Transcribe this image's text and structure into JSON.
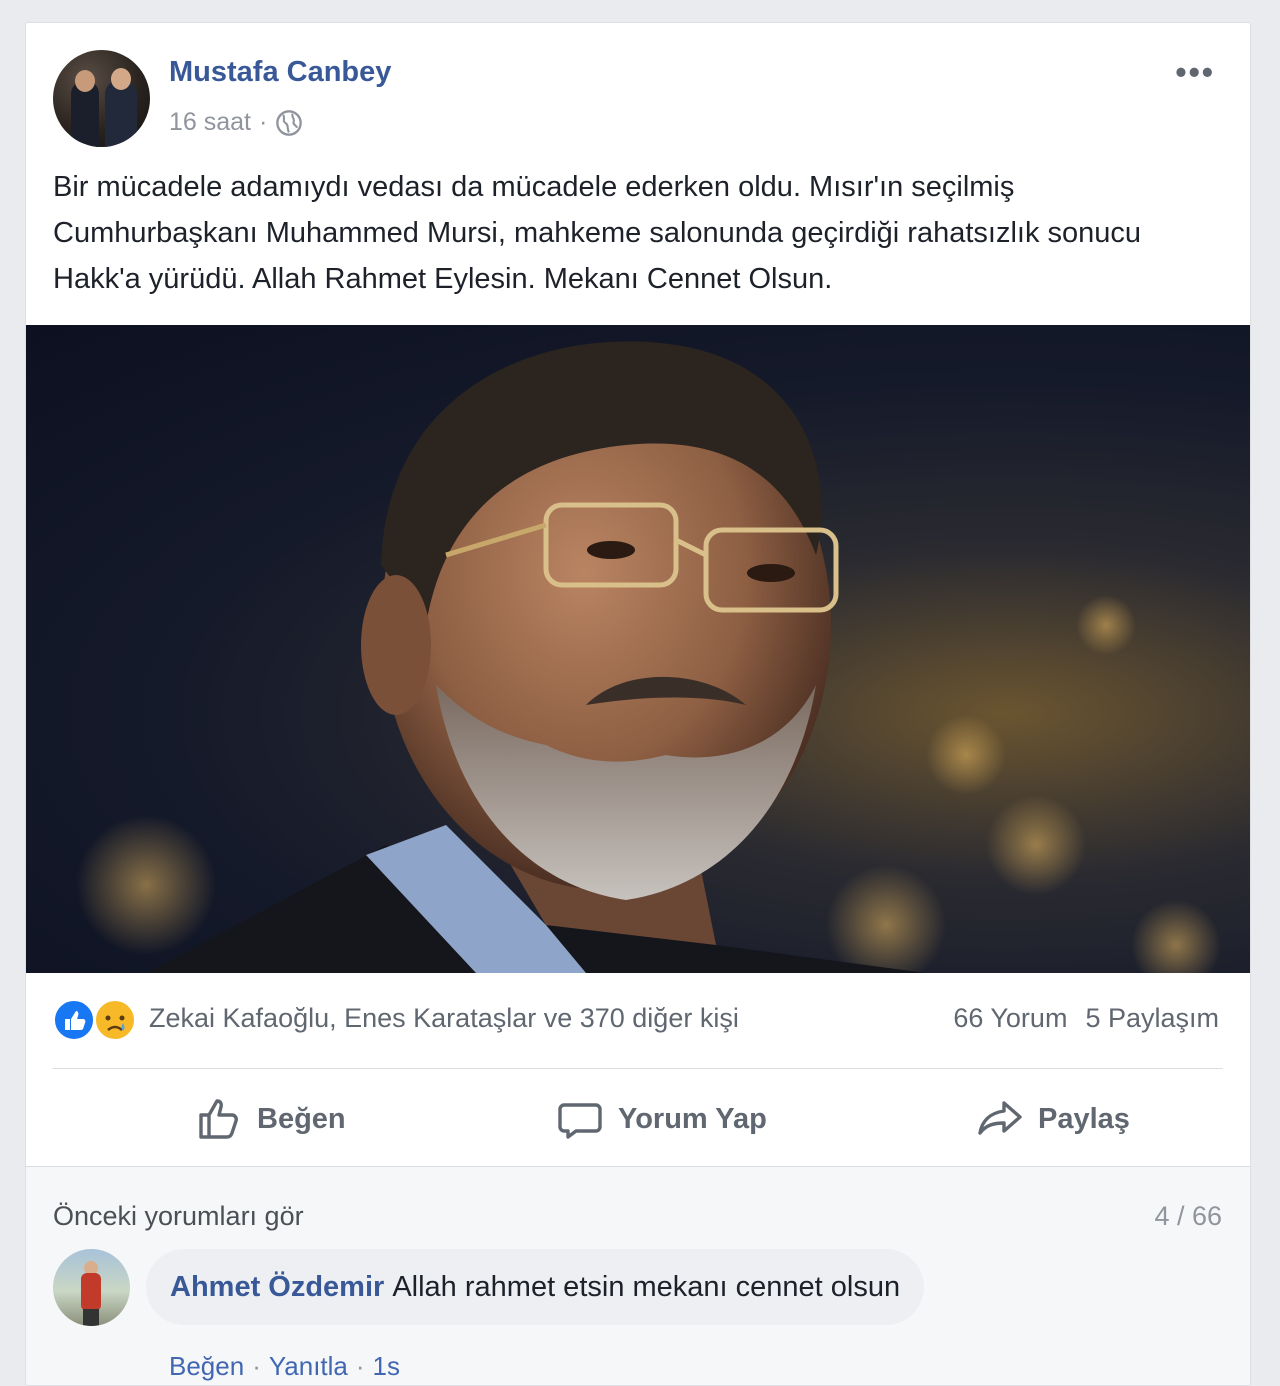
{
  "post": {
    "author": "Mustafa Canbey",
    "time": "16 saat",
    "separator": "·",
    "text": "Bir mücadele adamıydı vedası da mücadele ederken oldu. Mısır'ın seçilmiş Cumhurbaşkanı Muhammed Mursi, mahkeme salonunda geçirdiği rahatsızlık sonucu Hakk'a yürüdü. Allah Rahmet Eylesin. Mekanı Cennet Olsun.",
    "more_label": "•••"
  },
  "stats": {
    "likers": "Zekai Kafaoğlu, Enes Karataşlar ve 370 diğer kişi",
    "comments": "66 Yorum",
    "shares": "5 Paylaşım"
  },
  "actions": {
    "like": "Beğen",
    "comment": "Yorum Yap",
    "share": "Paylaş"
  },
  "comments": {
    "previous": "Önceki yorumları gör",
    "pager": "4 / 66",
    "items": [
      {
        "author": "Ahmet Özdemir",
        "text": "Allah rahmet etsin mekanı cennet olsun",
        "like": "Beğen",
        "reply": "Yanıtla",
        "time": "1s",
        "sep": "·"
      }
    ]
  },
  "colors": {
    "link": "#385898",
    "like_blue": "#1877f2",
    "sad_yellow": "#f7b928"
  }
}
